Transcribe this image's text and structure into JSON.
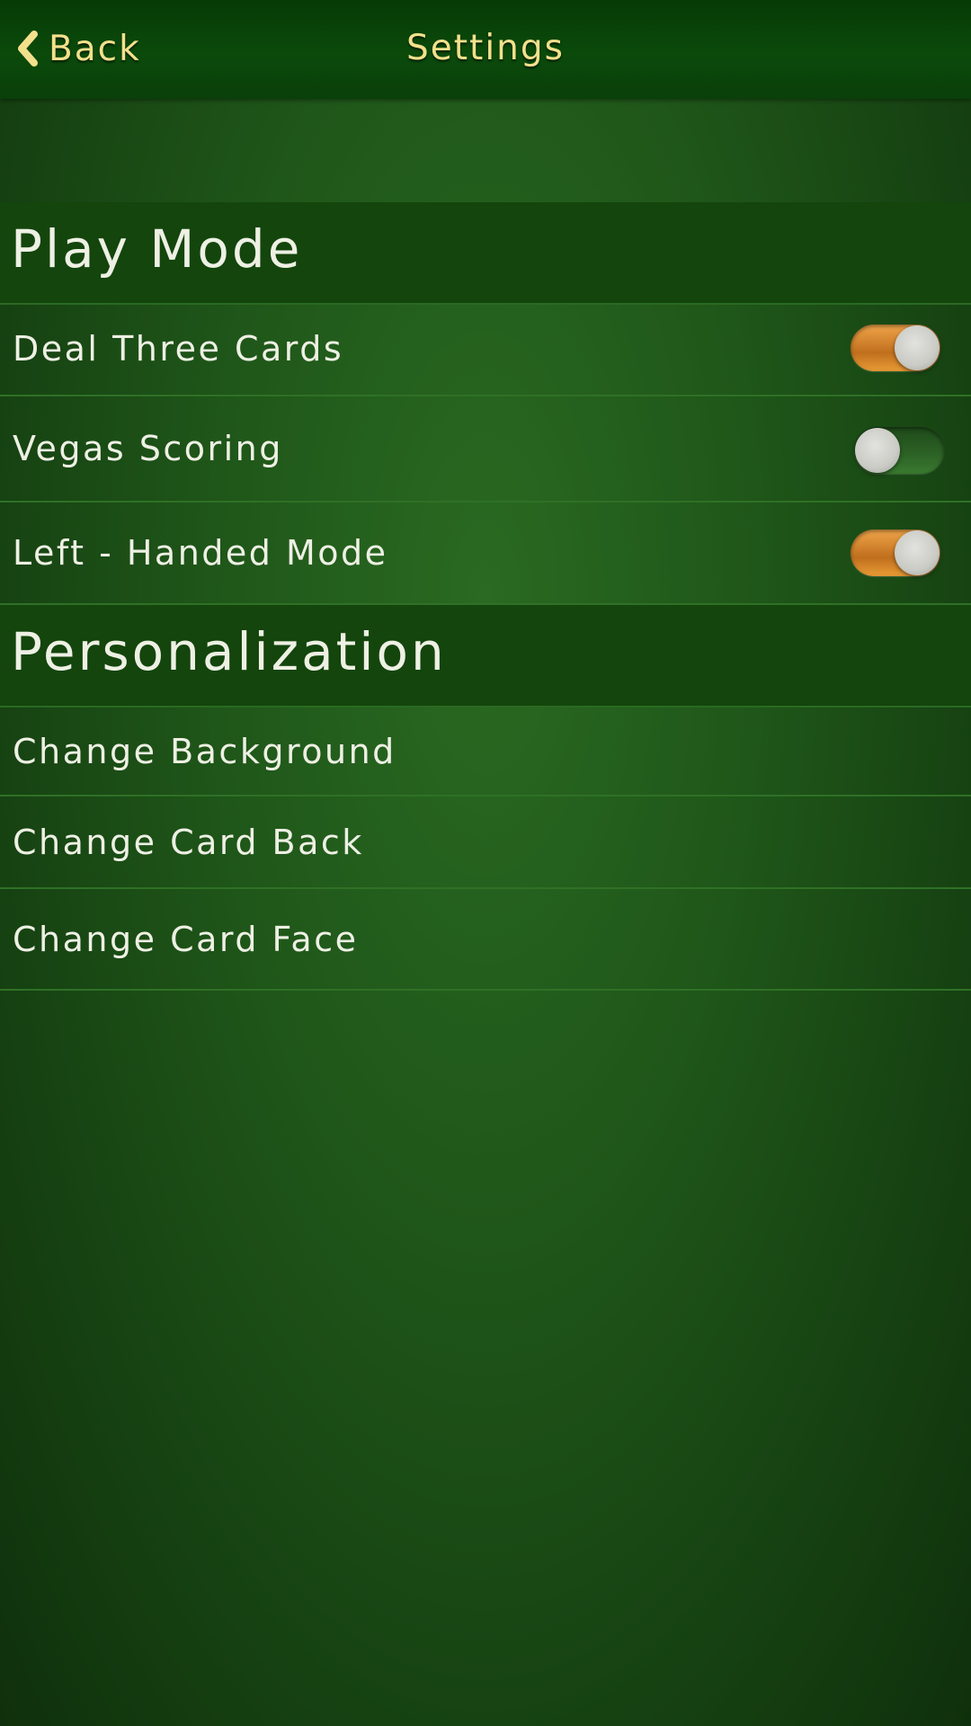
{
  "header": {
    "back_label": "Back",
    "back_icon": "chevron-left-icon",
    "title": "Settings"
  },
  "sections": [
    {
      "title": "Play Mode",
      "items": [
        {
          "label": "Deal Three Cards",
          "toggle": true
        },
        {
          "label": "Vegas Scoring",
          "toggle": false
        },
        {
          "label": "Left - Handed Mode",
          "toggle": true
        }
      ]
    },
    {
      "title": "Personalization",
      "items": [
        {
          "label": "Change Background"
        },
        {
          "label": "Change Card Back"
        },
        {
          "label": "Change Card Face"
        }
      ]
    }
  ],
  "colors": {
    "header_text": "#f3e08c",
    "toggle_on": "#e08a2c",
    "toggle_off": "#2d6326",
    "felt": "#1f5619"
  }
}
